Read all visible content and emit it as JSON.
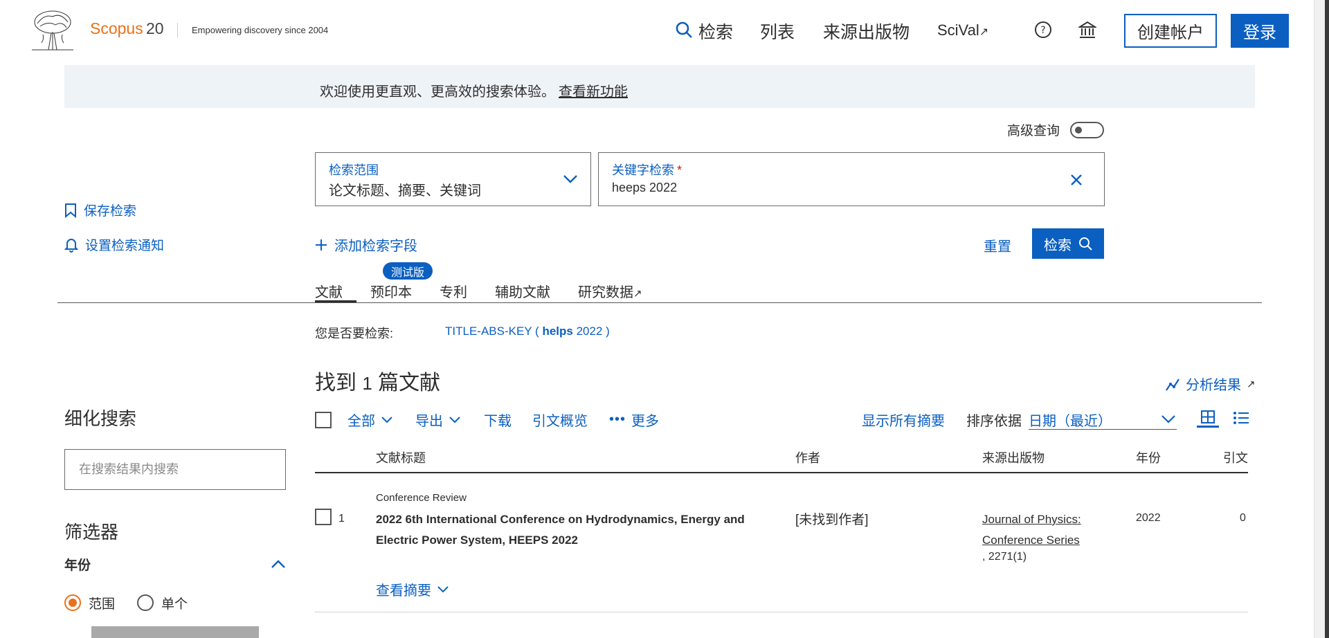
{
  "header": {
    "brand": "Scopus",
    "brand_suffix": "20",
    "tagline": "Empowering discovery since 2004",
    "nav": [
      "检索",
      "列表",
      "来源出版物",
      "SciVal"
    ],
    "create_account": "创建帐户",
    "login": "登录"
  },
  "banner": {
    "text": "欢迎使用更直观、更高效的搜索体验。",
    "link": "查看新功能"
  },
  "search": {
    "advanced_label": "高级查询",
    "scope_label": "检索范围",
    "scope_value": "论文标题、摘要、关键词",
    "keyword_label": "关键字检索",
    "keyword_required": "*",
    "keyword_value": "heeps 2022",
    "add_field": "添加检索字段",
    "reset": "重置",
    "search_button": "检索"
  },
  "sidebar": {
    "save_search": "保存检索",
    "set_alert": "设置检索通知",
    "refine_title": "细化搜索",
    "refine_placeholder": "在搜索结果内搜索",
    "filters_title": "筛选器",
    "year_label": "年份",
    "radio_range": "范围",
    "radio_single": "单个"
  },
  "tabs": {
    "items": [
      "文献",
      "预印本",
      "专利",
      "辅助文献",
      "研究数据"
    ],
    "beta_badge": "测试版"
  },
  "did_you_mean": {
    "label": "您是否要检索:",
    "prefix": "TITLE-ABS-KEY (",
    "term": "helps",
    "suffix": "2022 )"
  },
  "results": {
    "found_prefix": "找到",
    "count": "1",
    "found_suffix": "篇文献",
    "analyze": "分析结果",
    "toolbar": {
      "all": "全部",
      "export": "导出",
      "download": "下载",
      "citation_overview": "引文概览",
      "more": "更多",
      "show_abstracts": "显示所有摘要",
      "sort_label": "排序依据",
      "sort_value": "日期（最近）"
    },
    "columns": [
      "文献标题",
      "作者",
      "来源出版物",
      "年份",
      "引文"
    ],
    "rows": [
      {
        "num": "1",
        "type": "Conference Review",
        "title": "2022 6th International Conference on Hydrodynamics, Energy and Electric Power System, HEEPS 2022",
        "authors": "[未找到作者]",
        "source": "Journal of Physics: Conference Series",
        "volume": ", 2271(1)",
        "year": "2022",
        "cites": "0",
        "view_abstract": "查看摘要"
      }
    ]
  },
  "colors": {
    "brand": "#e9711c",
    "link": "#0b5fc1",
    "banner_bg": "#eef3f7"
  }
}
